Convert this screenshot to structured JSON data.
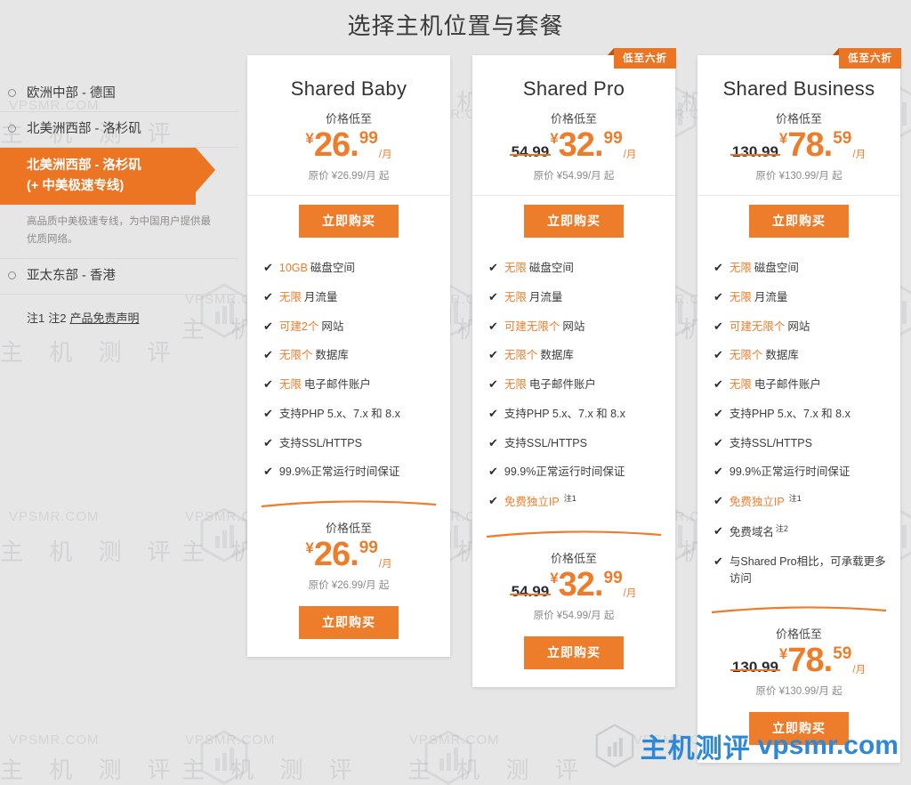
{
  "page": {
    "title": "选择主机位置与套餐",
    "background_color": "#e6e6e6",
    "accent_color": "#ee7d2b"
  },
  "sidebar": {
    "locations": [
      {
        "label": "欧洲中部 - 德国",
        "selected": false,
        "description": ""
      },
      {
        "label": "北美洲西部 - 洛杉矶",
        "selected": false,
        "description": ""
      },
      {
        "label": "北美洲西部 - 洛杉矶\n(+ 中美极速专线)",
        "line1": "北美洲西部 - 洛杉矶",
        "line2": "(+ 中美极速专线)",
        "selected": true,
        "description": "高品质中美极速专线，为中国用户提供最优质网络。"
      },
      {
        "label": "亚太东部 - 香港",
        "selected": false,
        "description": ""
      }
    ],
    "notes": {
      "note1": "注1",
      "note2": "注2",
      "disclaimer": "产品免责声明"
    }
  },
  "cards": [
    {
      "title": "Shared Baby",
      "badge": null,
      "price_caption": "价格低至",
      "currency": "¥",
      "old_price": null,
      "price_int": "26",
      "price_frac": "99",
      "per_month": "/月",
      "original_note": "原价 ¥26.99/月 起",
      "buy_label": "立即购买",
      "features": [
        {
          "highlight": "10GB",
          "text": "磁盘空间",
          "note": null
        },
        {
          "highlight": "无限",
          "text": "月流量",
          "note": null
        },
        {
          "highlight": "可建2个",
          "text": "网站",
          "note": null
        },
        {
          "highlight": "无限个",
          "text": "数据库",
          "note": null
        },
        {
          "highlight": "无限",
          "text": "电子邮件账户",
          "note": null
        },
        {
          "highlight": null,
          "text": "支持PHP 5.x、7.x 和 8.x",
          "note": null
        },
        {
          "highlight": null,
          "text": "支持SSL/HTTPS",
          "note": null
        },
        {
          "highlight": null,
          "text": "99.9%正常运行时间保证",
          "note": null
        }
      ],
      "footer": {
        "price_caption": "价格低至",
        "currency": "¥",
        "old_price": null,
        "price_int": "26",
        "price_frac": "99",
        "per_month": "/月",
        "original_note": "原价 ¥26.99/月 起",
        "buy_label": "立即购买"
      }
    },
    {
      "title": "Shared Pro",
      "badge": "低至六折",
      "price_caption": "价格低至",
      "currency": "¥",
      "old_price": "54.99",
      "price_int": "32",
      "price_frac": "99",
      "per_month": "/月",
      "original_note": "原价 ¥54.99/月 起",
      "buy_label": "立即购买",
      "features": [
        {
          "highlight": "无限",
          "text": "磁盘空间",
          "note": null
        },
        {
          "highlight": "无限",
          "text": "月流量",
          "note": null
        },
        {
          "highlight": "可建无限个",
          "text": "网站",
          "note": null
        },
        {
          "highlight": "无限个",
          "text": "数据库",
          "note": null
        },
        {
          "highlight": "无限",
          "text": "电子邮件账户",
          "note": null
        },
        {
          "highlight": null,
          "text": "支持PHP 5.x、7.x 和 8.x",
          "note": null
        },
        {
          "highlight": null,
          "text": "支持SSL/HTTPS",
          "note": null
        },
        {
          "highlight": null,
          "text": "99.9%正常运行时间保证",
          "note": null
        },
        {
          "highlight": "免费独立IP",
          "text": "",
          "note": "注1"
        }
      ],
      "footer": {
        "price_caption": "价格低至",
        "currency": "¥",
        "old_price": "54.99",
        "price_int": "32",
        "price_frac": "99",
        "per_month": "/月",
        "original_note": "原价 ¥54.99/月 起",
        "buy_label": "立即购买"
      }
    },
    {
      "title": "Shared Business",
      "badge": "低至六折",
      "price_caption": "价格低至",
      "currency": "¥",
      "old_price": "130.99",
      "price_int": "78",
      "price_frac": "59",
      "per_month": "/月",
      "original_note": "原价 ¥130.99/月 起",
      "buy_label": "立即购买",
      "features": [
        {
          "highlight": "无限",
          "text": "磁盘空间",
          "note": null
        },
        {
          "highlight": "无限",
          "text": "月流量",
          "note": null
        },
        {
          "highlight": "可建无限个",
          "text": "网站",
          "note": null
        },
        {
          "highlight": "无限个",
          "text": "数据库",
          "note": null
        },
        {
          "highlight": "无限",
          "text": "电子邮件账户",
          "note": null
        },
        {
          "highlight": null,
          "text": "支持PHP 5.x、7.x 和 8.x",
          "note": null
        },
        {
          "highlight": null,
          "text": "支持SSL/HTTPS",
          "note": null
        },
        {
          "highlight": null,
          "text": "99.9%正常运行时间保证",
          "note": null
        },
        {
          "highlight": "免费独立IP",
          "text": "",
          "note": "注1"
        },
        {
          "highlight": null,
          "text": "免费域名",
          "note": "注2"
        },
        {
          "highlight": null,
          "text": "与Shared Pro相比，可承载更多访问",
          "note": null
        }
      ],
      "footer": {
        "price_caption": "价格低至",
        "currency": "¥",
        "old_price": "130.99",
        "price_int": "78",
        "price_frac": "59",
        "per_month": "/月",
        "original_note": "原价 ¥130.99/月 起",
        "buy_label": "立即购买"
      }
    }
  ],
  "brand": {
    "cn": "主机测评",
    "url": "vpsmr.com",
    "color": "#2e88d8"
  },
  "watermarks": {
    "latin": "VPSMR.COM",
    "cn": "主 机 测 评"
  }
}
